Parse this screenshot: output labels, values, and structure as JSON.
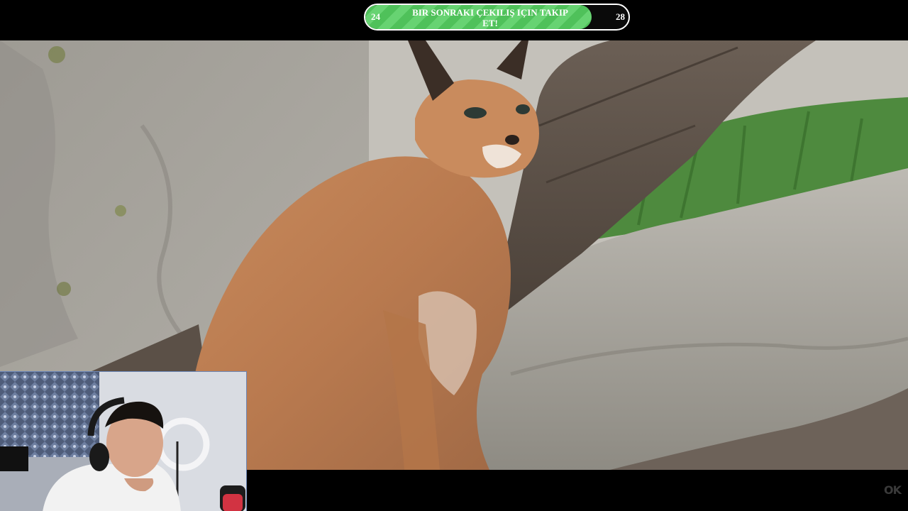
{
  "goal": {
    "start_value": "24",
    "end_value": "28",
    "label": "BIR SONRAKI ÇEKILIŞ IÇIN TAKIP ET!",
    "progress_fraction": 0.86,
    "fill_color": "#4fc15a"
  },
  "video": {
    "subject": "caracal-on-log"
  },
  "webcam": {
    "subject": "streamer-with-headphones"
  },
  "watermark": {
    "text": "OK"
  }
}
